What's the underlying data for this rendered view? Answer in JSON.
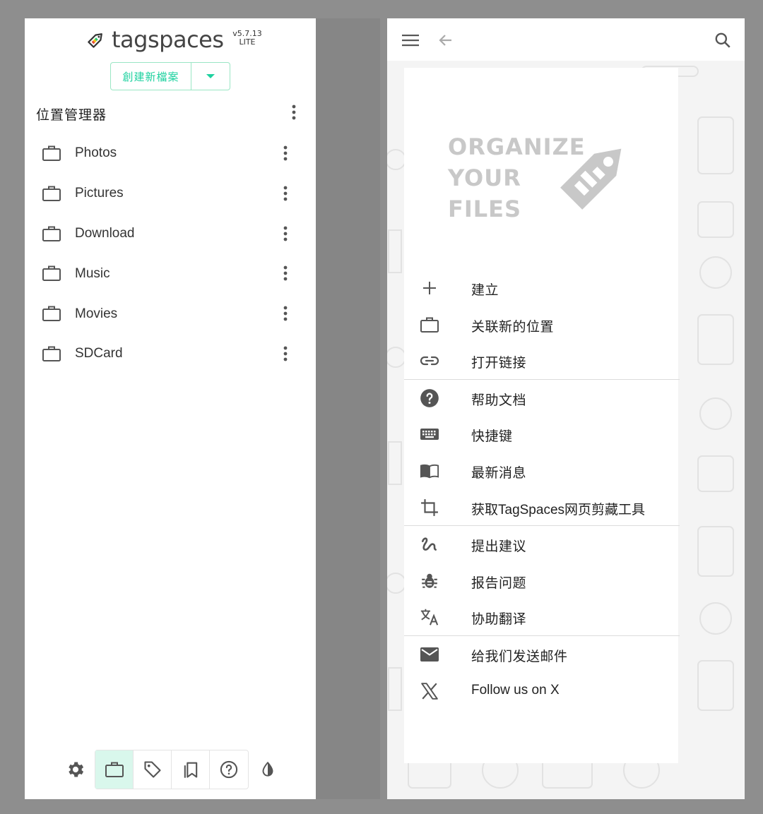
{
  "left_panel": {
    "logo": {
      "text": "tagspaces",
      "version": "v5.7.13",
      "edition": "LITE"
    },
    "create_button": {
      "label": "創建新檔案"
    },
    "locations_title": "位置管理器",
    "locations": [
      {
        "label": "Photos"
      },
      {
        "label": "Pictures"
      },
      {
        "label": "Download"
      },
      {
        "label": "Music"
      },
      {
        "label": "Movies"
      },
      {
        "label": "SDCard"
      }
    ],
    "bottom_icons": [
      "gear-icon",
      "briefcase-icon",
      "tag-icon",
      "bookmarks-icon",
      "help-circle-icon",
      "contrast-icon"
    ]
  },
  "right_panel": {
    "banner": {
      "line1": "ORGANIZE",
      "line2": "YOUR",
      "line3": "FILES"
    },
    "menu_groups": [
      [
        {
          "icon": "plus-icon",
          "label": "建立"
        },
        {
          "icon": "briefcase-icon",
          "label": "关联新的位置"
        },
        {
          "icon": "link-icon",
          "label": "打开链接"
        }
      ],
      [
        {
          "icon": "help-icon",
          "label": "帮助文档"
        },
        {
          "icon": "keyboard-icon",
          "label": "快捷键"
        },
        {
          "icon": "book-icon",
          "label": "最新消息"
        },
        {
          "icon": "crop-icon",
          "label": "获取TagSpaces网页剪藏工具"
        }
      ],
      [
        {
          "icon": "draw-icon",
          "label": "提出建议"
        },
        {
          "icon": "bug-icon",
          "label": "报告问题"
        },
        {
          "icon": "translate-icon",
          "label": "协助翻译"
        }
      ],
      [
        {
          "icon": "mail-icon",
          "label": "给我们发送邮件"
        },
        {
          "icon": "x-logo-icon",
          "label": "Follow us on X"
        }
      ]
    ]
  },
  "colors": {
    "accent": "#1dd19f",
    "accent_border": "#9ae6c4",
    "active_bg": "#d9f7ec",
    "icon": "#555555",
    "overlay": "#7b7b7b"
  }
}
